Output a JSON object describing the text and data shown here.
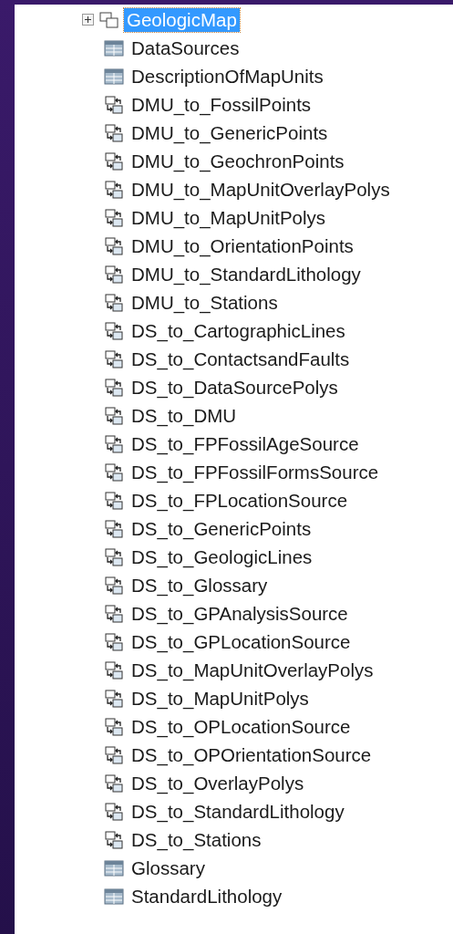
{
  "tree": {
    "root": {
      "label": "GeologicMap",
      "kind": "dataset",
      "expanded": false,
      "selected": true
    },
    "items": [
      {
        "label": "DataSources",
        "kind": "table"
      },
      {
        "label": "DescriptionOfMapUnits",
        "kind": "table"
      },
      {
        "label": "DMU_to_FossilPoints",
        "kind": "relationship"
      },
      {
        "label": "DMU_to_GenericPoints",
        "kind": "relationship"
      },
      {
        "label": "DMU_to_GeochronPoints",
        "kind": "relationship"
      },
      {
        "label": "DMU_to_MapUnitOverlayPolys",
        "kind": "relationship"
      },
      {
        "label": "DMU_to_MapUnitPolys",
        "kind": "relationship"
      },
      {
        "label": "DMU_to_OrientationPoints",
        "kind": "relationship"
      },
      {
        "label": "DMU_to_StandardLithology",
        "kind": "relationship"
      },
      {
        "label": "DMU_to_Stations",
        "kind": "relationship"
      },
      {
        "label": "DS_to_CartographicLines",
        "kind": "relationship"
      },
      {
        "label": "DS_to_ContactsandFaults",
        "kind": "relationship"
      },
      {
        "label": "DS_to_DataSourcePolys",
        "kind": "relationship"
      },
      {
        "label": "DS_to_DMU",
        "kind": "relationship"
      },
      {
        "label": "DS_to_FPFossilAgeSource",
        "kind": "relationship"
      },
      {
        "label": "DS_to_FPFossilFormsSource",
        "kind": "relationship"
      },
      {
        "label": "DS_to_FPLocationSource",
        "kind": "relationship"
      },
      {
        "label": "DS_to_GenericPoints",
        "kind": "relationship"
      },
      {
        "label": "DS_to_GeologicLines",
        "kind": "relationship"
      },
      {
        "label": "DS_to_Glossary",
        "kind": "relationship"
      },
      {
        "label": "DS_to_GPAnalysisSource",
        "kind": "relationship"
      },
      {
        "label": "DS_to_GPLocationSource",
        "kind": "relationship"
      },
      {
        "label": "DS_to_MapUnitOverlayPolys",
        "kind": "relationship"
      },
      {
        "label": "DS_to_MapUnitPolys",
        "kind": "relationship"
      },
      {
        "label": "DS_to_OPLocationSource",
        "kind": "relationship"
      },
      {
        "label": "DS_to_OPOrientationSource",
        "kind": "relationship"
      },
      {
        "label": "DS_to_OverlayPolys",
        "kind": "relationship"
      },
      {
        "label": "DS_to_StandardLithology",
        "kind": "relationship"
      },
      {
        "label": "DS_to_Stations",
        "kind": "relationship"
      },
      {
        "label": "Glossary",
        "kind": "table"
      },
      {
        "label": "StandardLithology",
        "kind": "table"
      }
    ]
  }
}
